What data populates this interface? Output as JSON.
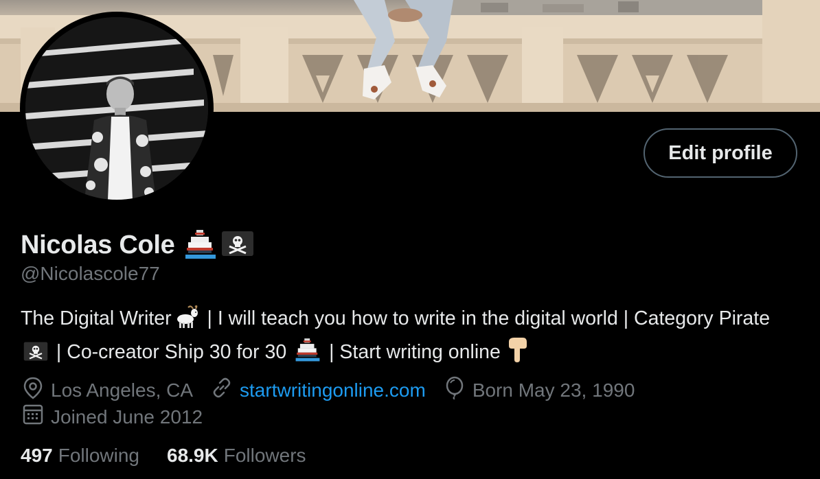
{
  "profile": {
    "display_name": "Nicolas Cole",
    "handle": "@Nicolascole77",
    "edit_button_label": "Edit profile",
    "name_emojis": [
      "ship-emoji",
      "pirate-flag-emoji"
    ]
  },
  "bio": {
    "segment_1": "The Digital Writer",
    "segment_2": "| I will teach you how to write in the digital world | Category Pirate",
    "segment_3": "| Co-creator Ship 30 for 30",
    "segment_4": "| Start writing online",
    "icons": [
      "goat-emoji",
      "pirate-flag-emoji",
      "ship-emoji",
      "pointing-down-emoji"
    ]
  },
  "meta": {
    "location": "Los Angeles, CA",
    "website": "startwritingonline.com",
    "birthday": "Born May 23, 1990",
    "joined": "Joined June 2012"
  },
  "stats": {
    "following_count": "497",
    "following_label": "Following",
    "followers_count": "68.9K",
    "followers_label": "Followers"
  },
  "colors": {
    "background": "#000000",
    "text_primary": "#e7e9ea",
    "text_secondary": "#71767b",
    "link": "#1d9bf0",
    "button_border": "#536471"
  }
}
